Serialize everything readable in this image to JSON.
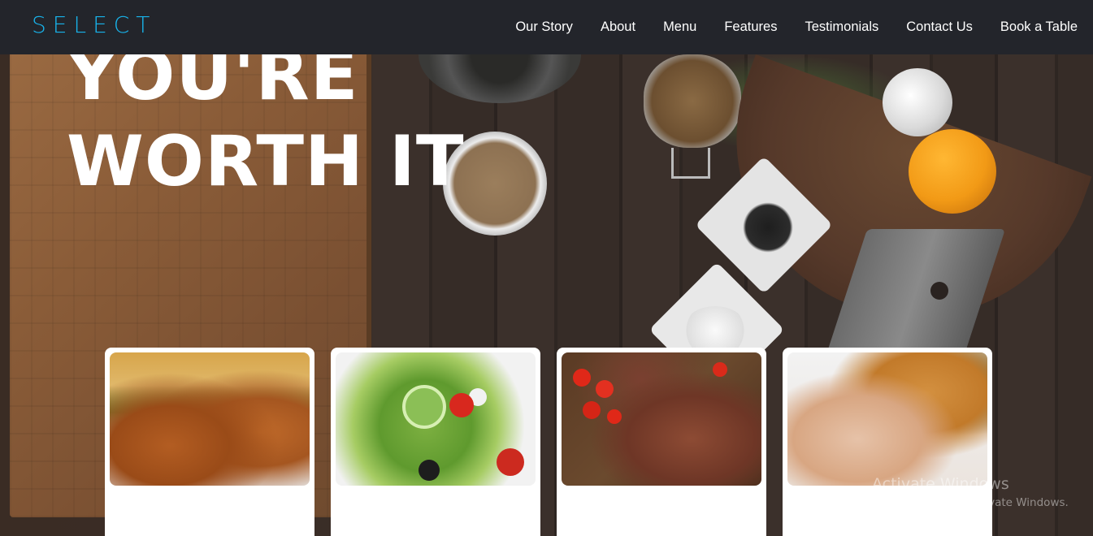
{
  "brand": {
    "logo": "SELECT",
    "accent": "#18b4ec"
  },
  "nav": {
    "items": [
      {
        "label": "Our Story"
      },
      {
        "label": "About"
      },
      {
        "label": "Menu"
      },
      {
        "label": "Features"
      },
      {
        "label": "Testimonials"
      },
      {
        "label": "Contact Us"
      },
      {
        "label": "Book a Table"
      }
    ]
  },
  "hero": {
    "line1": "YOU'RE",
    "line2": "WORTH IT"
  },
  "cards": [
    {
      "image": "fried-chicken-fries-photo"
    },
    {
      "image": "greek-salad-photo"
    },
    {
      "image": "grilled-steak-photo"
    },
    {
      "image": "roast-chicken-potatoes-photo"
    }
  ],
  "watermark": {
    "title": "Activate Windows",
    "subtitle": "Go to Settings to activate Windows."
  }
}
